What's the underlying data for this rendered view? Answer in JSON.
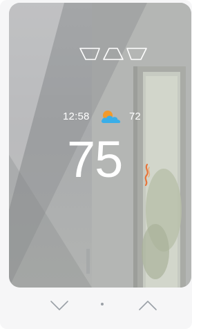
{
  "thermostat": {
    "time": "12:58",
    "outdoor_temp": "72",
    "setpoint": "75",
    "weather": {
      "icon": "partly-cloudy-icon",
      "sun_color": "#f39a2b",
      "cloud_color": "#3aaee8"
    },
    "mode_icons": [
      "mode-icon-left",
      "mode-icon-center",
      "mode-icon-right"
    ],
    "heat_icon": "heat-flame-icon",
    "heat_color": "#e8743a",
    "controls": {
      "down_icon": "chevron-down-icon",
      "up_icon": "chevron-up-icon"
    }
  }
}
